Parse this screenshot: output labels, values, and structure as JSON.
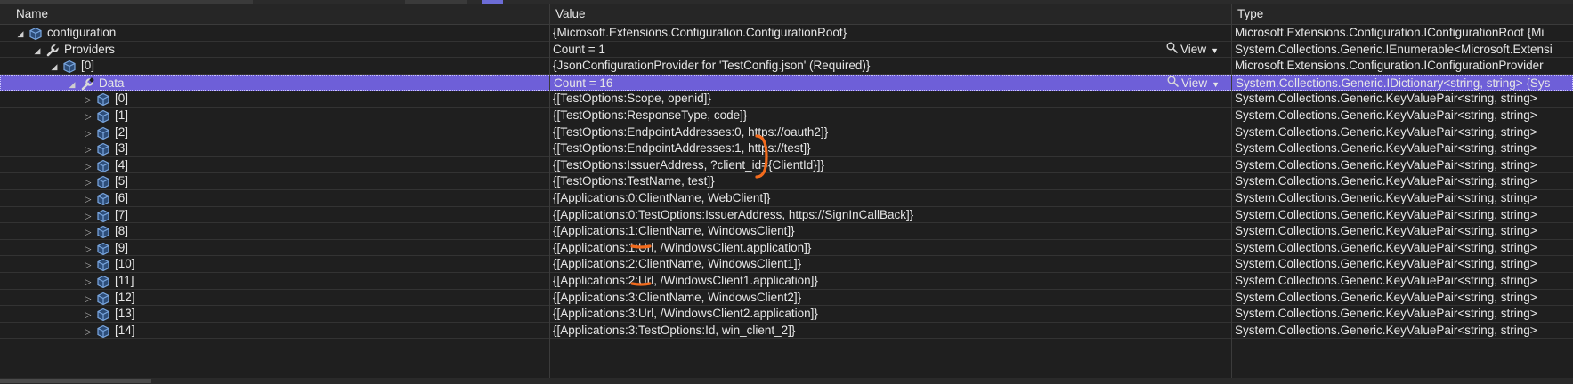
{
  "columns": {
    "name": "Name",
    "value": "Value",
    "type": "Type"
  },
  "view_label": "View",
  "rows": [
    {
      "name": "configuration",
      "value": "{Microsoft.Extensions.Configuration.ConfigurationRoot}",
      "type": "Microsoft.Extensions.Configuration.IConfigurationRoot {Mi",
      "level": 0,
      "expanded": true,
      "icon": "cube-icon"
    },
    {
      "name": "Providers",
      "value": "Count = 1",
      "type": "System.Collections.Generic.IEnumerable<Microsoft.Extensi",
      "level": 1,
      "expanded": true,
      "icon": "wrench-icon",
      "view": true
    },
    {
      "name": "[0]",
      "value": "{JsonConfigurationProvider for 'TestConfig.json' (Required)}",
      "type": "Microsoft.Extensions.Configuration.IConfigurationProvider",
      "level": 2,
      "expanded": true,
      "icon": "cube-icon"
    },
    {
      "name": "Data",
      "value": "Count = 16",
      "type": "System.Collections.Generic.IDictionary<string, string> {Sys",
      "level": 3,
      "expanded": true,
      "icon": "wrench-icon",
      "view": true,
      "selected": true
    },
    {
      "name": "[0]",
      "value": "{[TestOptions:Scope, openid]}",
      "type": "System.Collections.Generic.KeyValuePair<string, string>",
      "level": 4,
      "expanded": false,
      "icon": "cube-icon"
    },
    {
      "name": "[1]",
      "value": "{[TestOptions:ResponseType, code]}",
      "type": "System.Collections.Generic.KeyValuePair<string, string>",
      "level": 4,
      "expanded": false,
      "icon": "cube-icon"
    },
    {
      "name": "[2]",
      "value": "{[TestOptions:EndpointAddresses:0, https://oauth2]}",
      "type": "System.Collections.Generic.KeyValuePair<string, string>",
      "level": 4,
      "expanded": false,
      "icon": "cube-icon"
    },
    {
      "name": "[3]",
      "value": "{[TestOptions:EndpointAddresses:1, https://test]}",
      "type": "System.Collections.Generic.KeyValuePair<string, string>",
      "level": 4,
      "expanded": false,
      "icon": "cube-icon"
    },
    {
      "name": "[4]",
      "value": "{[TestOptions:IssuerAddress, ?client_id={ClientId}]}",
      "type": "System.Collections.Generic.KeyValuePair<string, string>",
      "level": 4,
      "expanded": false,
      "icon": "cube-icon"
    },
    {
      "name": "[5]",
      "value": "{[TestOptions:TestName, test]}",
      "type": "System.Collections.Generic.KeyValuePair<string, string>",
      "level": 4,
      "expanded": false,
      "icon": "cube-icon"
    },
    {
      "name": "[6]",
      "value": "{[Applications:0:ClientName, WebClient]}",
      "type": "System.Collections.Generic.KeyValuePair<string, string>",
      "level": 4,
      "expanded": false,
      "icon": "cube-icon"
    },
    {
      "name": "[7]",
      "value": "{[Applications:0:TestOptions:IssuerAddress, https://SignInCallBack]}",
      "type": "System.Collections.Generic.KeyValuePair<string, string>",
      "level": 4,
      "expanded": false,
      "icon": "cube-icon"
    },
    {
      "name": "[8]",
      "value": "{[Applications:1:ClientName, WindowsClient]}",
      "type": "System.Collections.Generic.KeyValuePair<string, string>",
      "level": 4,
      "expanded": false,
      "icon": "cube-icon"
    },
    {
      "name": "[9]",
      "value": "{[Applications:1:Url, /WindowsClient.application]}",
      "type": "System.Collections.Generic.KeyValuePair<string, string>",
      "level": 4,
      "expanded": false,
      "icon": "cube-icon"
    },
    {
      "name": "[10]",
      "value": "{[Applications:2:ClientName, WindowsClient1]}",
      "type": "System.Collections.Generic.KeyValuePair<string, string>",
      "level": 4,
      "expanded": false,
      "icon": "cube-icon"
    },
    {
      "name": "[11]",
      "value": "{[Applications:2:Url, /WindowsClient1.application]}",
      "type": "System.Collections.Generic.KeyValuePair<string, string>",
      "level": 4,
      "expanded": false,
      "icon": "cube-icon"
    },
    {
      "name": "[12]",
      "value": "{[Applications:3:ClientName, WindowsClient2]}",
      "type": "System.Collections.Generic.KeyValuePair<string, string>",
      "level": 4,
      "expanded": false,
      "icon": "cube-icon"
    },
    {
      "name": "[13]",
      "value": "{[Applications:3:Url, /WindowsClient2.application]}",
      "type": "System.Collections.Generic.KeyValuePair<string, string>",
      "level": 4,
      "expanded": false,
      "icon": "cube-icon"
    },
    {
      "name": "[14]",
      "value": "{[Applications:3:TestOptions:Id, win_client_2]}",
      "type": "System.Collections.Generic.KeyValuePair<string, string>",
      "level": 4,
      "expanded": false,
      "icon": "cube-icon"
    }
  ],
  "colors": {
    "selection": "#6e5fd8",
    "annotation": "#f26b1d",
    "icon_blue": "#7aa7e0",
    "background": "#1f1f1f"
  }
}
